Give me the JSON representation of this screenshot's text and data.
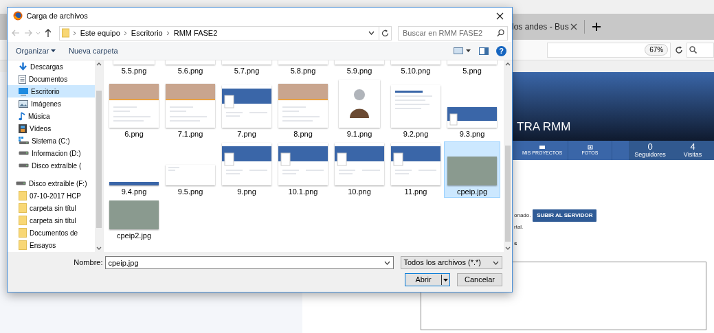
{
  "browser": {
    "tab_title": "los andes - Bus",
    "zoom": "67%",
    "page": {
      "header_title": "TRA RMM",
      "nav_items": [
        {
          "label": "MIS PROYECTOS",
          "kind": "folder"
        },
        {
          "label": "FOTOS",
          "kind": "camera"
        }
      ],
      "stats": [
        {
          "value": "0",
          "label": "Seguidores"
        },
        {
          "value": "4",
          "label": "Visitas"
        }
      ],
      "upload_row": {
        "text": "onado.",
        "button": "SUBIR AL SERVIDOR"
      },
      "lines": [
        "rtal.",
        "s"
      ]
    }
  },
  "dialog": {
    "title": "Carga de archivos",
    "breadcrumb": [
      "Este equipo",
      "Escritorio",
      "RMM FASE2"
    ],
    "search": {
      "placeholder": "Buscar en RMM FASE2"
    },
    "toolbar": {
      "organize": "Organizar",
      "new_folder": "Nueva carpeta",
      "help": "?"
    },
    "nav": [
      {
        "label": "Descargas",
        "kind": "download",
        "selected": false
      },
      {
        "label": "Documentos",
        "kind": "document",
        "selected": false
      },
      {
        "label": "Escritorio",
        "kind": "desktop",
        "selected": true
      },
      {
        "label": "Imágenes",
        "kind": "image",
        "selected": false
      },
      {
        "label": "Música",
        "kind": "music",
        "selected": false
      },
      {
        "label": "Vídeos",
        "kind": "video",
        "selected": false
      },
      {
        "label": "Sistema (C:)",
        "kind": "system-drive",
        "selected": false
      },
      {
        "label": "Informacion (D:)",
        "kind": "drive",
        "selected": false
      },
      {
        "label": "Disco extraíble (",
        "kind": "drive",
        "selected": false
      },
      {
        "label": "Disco extraíble (F:)",
        "kind": "drive",
        "selected": false,
        "children": [
          {
            "label": "07-10-2017 HCP",
            "kind": "folder",
            "selected": false
          },
          {
            "label": "carpeta sin títul",
            "kind": "folder",
            "selected": false
          },
          {
            "label": "carpeta sin títul",
            "kind": "folder",
            "selected": false
          },
          {
            "label": "Documentos de",
            "kind": "folder",
            "selected": false
          },
          {
            "label": "Ensayos",
            "kind": "folder",
            "selected": false
          }
        ]
      }
    ],
    "files": [
      {
        "name": "5.5.png",
        "kind": "portrait",
        "selected": false
      },
      {
        "name": "5.6.png",
        "kind": "doc",
        "selected": false
      },
      {
        "name": "5.7.png",
        "kind": "doc",
        "selected": false
      },
      {
        "name": "5.8.png",
        "kind": "doc",
        "selected": false
      },
      {
        "name": "5.9.png",
        "kind": "doc",
        "selected": false
      },
      {
        "name": "5.10.png",
        "kind": "doc",
        "selected": false
      },
      {
        "name": "5.png",
        "kind": "doc",
        "selected": false
      },
      {
        "name": "6.png",
        "kind": "people",
        "selected": false
      },
      {
        "name": "7.1.png",
        "kind": "people",
        "selected": false
      },
      {
        "name": "7.png",
        "kind": "page",
        "selected": false
      },
      {
        "name": "8.png",
        "kind": "people",
        "selected": false
      },
      {
        "name": "9.1.png",
        "kind": "portrait",
        "selected": false
      },
      {
        "name": "9.2.png",
        "kind": "doc",
        "selected": false
      },
      {
        "name": "9.3.png",
        "kind": "banner",
        "selected": false
      },
      {
        "name": "9.4.png",
        "kind": "strip",
        "selected": false
      },
      {
        "name": "9.5.png",
        "kind": "blank",
        "selected": false
      },
      {
        "name": "9.png",
        "kind": "page",
        "selected": false
      },
      {
        "name": "10.1.png",
        "kind": "page",
        "selected": false
      },
      {
        "name": "10.png",
        "kind": "page",
        "selected": false
      },
      {
        "name": "11.png",
        "kind": "page",
        "selected": false
      },
      {
        "name": "cpeip.jpg",
        "kind": "photo",
        "selected": true
      },
      {
        "name": "cpeip2.jpg",
        "kind": "photo",
        "selected": false
      }
    ],
    "file_name": {
      "label": "Nombre:",
      "value": "cpeip.jpg"
    },
    "file_type": "Todos los archivos (*.*)",
    "buttons": {
      "open": "Abrir",
      "cancel": "Cancelar"
    }
  }
}
